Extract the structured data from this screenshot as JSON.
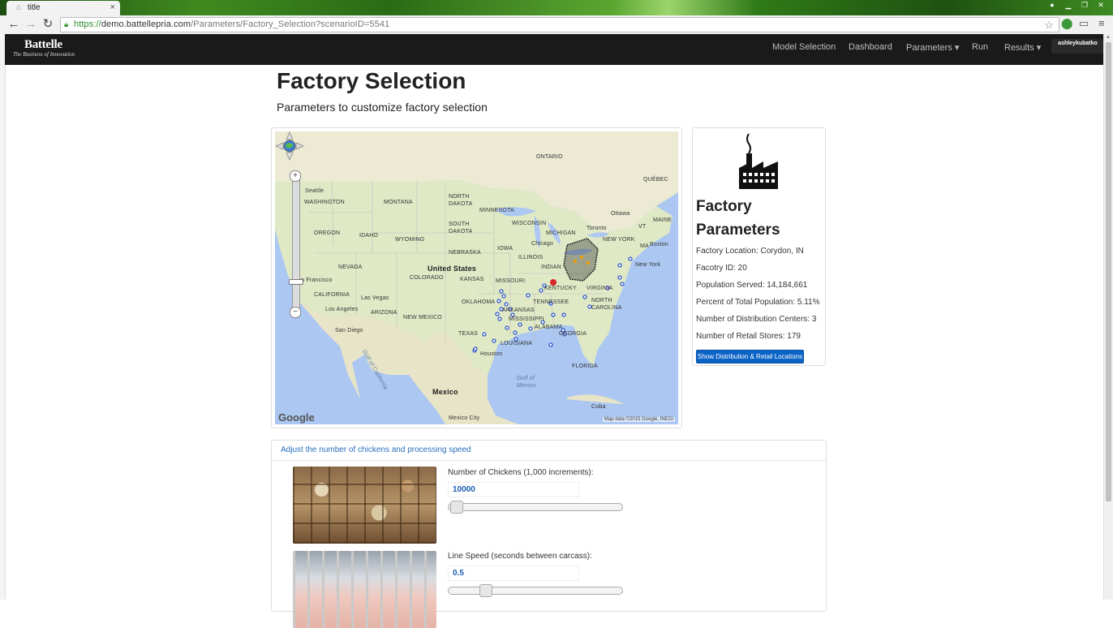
{
  "browser": {
    "tab_title": "title",
    "tab_close": "×",
    "url_protocol": "https://",
    "url_host": "demo.battellepria.com",
    "url_path": "/Parameters/Factory_Selection?scenarioID=5541"
  },
  "navbar": {
    "brand_name": "Battelle",
    "brand_tagline": "The Business of Innovation",
    "items": [
      {
        "label": "Model Selection"
      },
      {
        "label": "Dashboard"
      },
      {
        "label": "Parameters ▾"
      },
      {
        "label": "Run"
      },
      {
        "label": "Results ▾"
      }
    ],
    "user": "ashleykubatko"
  },
  "page": {
    "title": "Factory Selection",
    "subtitle": "Parameters to customize factory selection"
  },
  "map": {
    "labels": {
      "ontario": "ONTARIO",
      "north_dakota": "NORTH DAKOTA",
      "minnesota": "MINNESOTA",
      "quebec": "QUÉBEC",
      "seattle": "Seattle",
      "washington": "WASHINGTON",
      "montana": "MONTANA",
      "south_dakota": "SOUTH DAKOTA",
      "wisconsin": "WISCONSIN",
      "michigan": "MICHIGAN",
      "ottawa": "Ottawa",
      "toronto": "Toronto",
      "vt": "VT",
      "maine": "MAINE",
      "oregon": "OREGON",
      "idaho": "IDAHO",
      "wyoming": "WYOMING",
      "new_york_state": "NEW YORK",
      "boston": "Boston",
      "ma": "MA",
      "chicago": "Chicago",
      "nebraska": "NEBRASKA",
      "iowa": "IOWA",
      "illinois": "ILLINOIS",
      "indiana": "INDIAN",
      "nevada": "NEVADA",
      "united_states": "United States",
      "colorado": "COLORADO",
      "kansas": "KANSAS",
      "missouri": "MISSOURI",
      "new_york_city": "New York",
      "san_francisco": "an Francisco",
      "kentucky": "KENTUCKY",
      "virginia": "VIRGINIA",
      "california": "CALIFORNIA",
      "las_vegas": "Las Vegas",
      "oklahoma": "OKLAHOMA",
      "tennessee": "TENNESSEE",
      "north_carolina": "NORTH CAROLINA",
      "los_angeles": "Los Angeles",
      "arizona": "ARIZONA",
      "new_mexico": "NEW MEXICO",
      "arkansas": "ARKANSAS",
      "mississippi": "MISSISSIPPI",
      "alabama": "ALABAMA",
      "georgia": "GEORGIA",
      "san_diego": "San Diego",
      "texas": "TEXAS",
      "louisiana": "LOUISIANA",
      "gulf_of_california": "Gulf of California",
      "houston": "Houston",
      "florida": "FLORIDA",
      "gulf_of_mexico": "Gulf of Mexico",
      "mexico": "Mexico",
      "cuba": "Cuba",
      "mexico_city": "Mexico City"
    },
    "logo": "Google",
    "attribution": "Map data ©2015 Google, INEGI",
    "zoom_in": "+",
    "zoom_out": "−"
  },
  "factory": {
    "title": "Factory Parameters",
    "location": "Factory Location: Corydon, IN",
    "id": "Facotry ID: 20",
    "population": "Population Served: 14,184,661",
    "percent": "Percent of Total Population: 5.11%",
    "distribution_centers": "Number of Distribution Centers: 3",
    "retail_stores": "Number of Retail Stores: 179",
    "button": "Show Distribution & Retail Locations"
  },
  "settings": {
    "header": "Adjust the number of chickens and processing speed",
    "chickens_label": "Number of Chickens (1,000 increments):",
    "chickens_value": "10000",
    "speed_label": "Line Speed (seconds between carcass):",
    "speed_value": "0.5"
  },
  "colors": {
    "navbar_bg": "#1a1a1a",
    "button_blue": "#0b63c6",
    "link_blue": "#2a6ebd",
    "factory_marker": "#d9262c",
    "store_marker": "#2f55c9"
  }
}
